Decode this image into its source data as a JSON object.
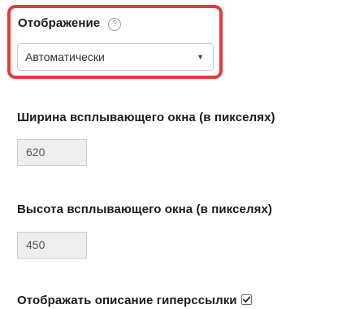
{
  "display": {
    "label": "Отображение",
    "help_icon": "question-circle-icon",
    "selected": "Автоматически",
    "arrow": "▼"
  },
  "popup_width": {
    "label": "Ширина всплывающего окна (в пикселях)",
    "value": "620"
  },
  "popup_height": {
    "label": "Высота всплывающего окна (в пикселях)",
    "value": "450"
  },
  "show_description": {
    "label": "Отображать описание гиперссылки",
    "checked": true
  },
  "colors": {
    "highlight": "#e43b3b",
    "input_bg": "#eeeeee"
  }
}
